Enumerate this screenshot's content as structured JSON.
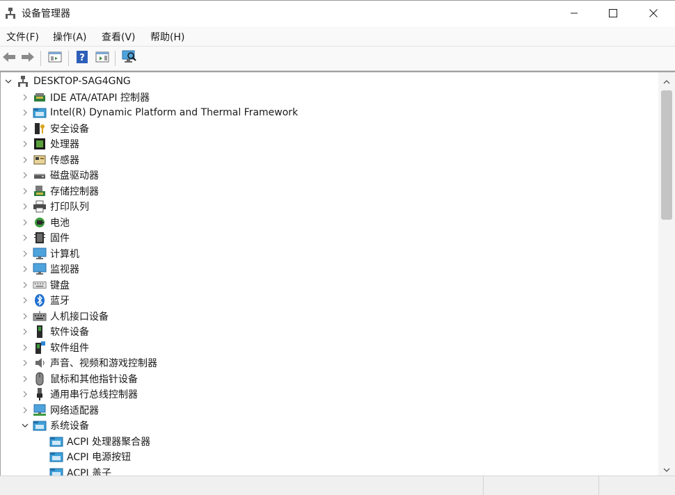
{
  "window": {
    "title": "设备管理器",
    "icon": "device-manager-icon",
    "controls": [
      "minimize-icon",
      "maximize-icon",
      "close-icon"
    ]
  },
  "menu": {
    "items": [
      {
        "label": "文件(F)"
      },
      {
        "label": "操作(A)"
      },
      {
        "label": "查看(V)"
      },
      {
        "label": "帮助(H)"
      }
    ]
  },
  "toolbar": {
    "buttons": [
      "back-arrow-icon",
      "forward-arrow-icon",
      "show-hide-console-tree-icon",
      "help-icon",
      "properties-pane-icon",
      "scan-hardware-icon"
    ]
  },
  "tree": {
    "root": {
      "label": "DESKTOP-SAG4GNG",
      "icon": "computer-network-icon",
      "expanded": true
    },
    "categories": [
      {
        "label": "IDE ATA/ATAPI 控制器",
        "icon": "ide-controller-icon",
        "expanded": false
      },
      {
        "label": "Intel(R) Dynamic Platform and Thermal Framework",
        "icon": "system-folder-icon",
        "expanded": false
      },
      {
        "label": "安全设备",
        "icon": "security-key-icon",
        "expanded": false
      },
      {
        "label": "处理器",
        "icon": "processor-chip-icon",
        "expanded": false
      },
      {
        "label": "传感器",
        "icon": "sensor-icon",
        "expanded": false
      },
      {
        "label": "磁盘驱动器",
        "icon": "disk-drive-icon",
        "expanded": false
      },
      {
        "label": "存储控制器",
        "icon": "storage-controller-icon",
        "expanded": false
      },
      {
        "label": "打印队列",
        "icon": "printer-icon",
        "expanded": false
      },
      {
        "label": "电池",
        "icon": "battery-icon",
        "expanded": false
      },
      {
        "label": "固件",
        "icon": "firmware-icon",
        "expanded": false
      },
      {
        "label": "计算机",
        "icon": "monitor-icon",
        "expanded": false
      },
      {
        "label": "监视器",
        "icon": "monitor-icon",
        "expanded": false
      },
      {
        "label": "键盘",
        "icon": "keyboard-icon",
        "expanded": false
      },
      {
        "label": "蓝牙",
        "icon": "bluetooth-icon",
        "expanded": false
      },
      {
        "label": "人机接口设备",
        "icon": "hid-icon",
        "expanded": false
      },
      {
        "label": "软件设备",
        "icon": "software-device-icon",
        "expanded": false
      },
      {
        "label": "软件组件",
        "icon": "software-component-icon",
        "expanded": false
      },
      {
        "label": "声音、视频和游戏控制器",
        "icon": "speaker-icon",
        "expanded": false
      },
      {
        "label": "鼠标和其他指针设备",
        "icon": "mouse-icon",
        "expanded": false
      },
      {
        "label": "通用串行总线控制器",
        "icon": "usb-icon",
        "expanded": false
      },
      {
        "label": "网络适配器",
        "icon": "network-adapter-icon",
        "expanded": false
      },
      {
        "label": "系统设备",
        "icon": "system-folder-icon",
        "expanded": true
      }
    ],
    "system_devices": [
      {
        "label": "ACPI 处理器聚合器",
        "icon": "system-folder-icon"
      },
      {
        "label": "ACPI 电源按钮",
        "icon": "system-folder-icon"
      },
      {
        "label": "ACPI 盖子",
        "icon": "system-folder-icon"
      }
    ]
  },
  "colors": {
    "accent_blue": "#2e86d6",
    "bluetooth_blue": "#1e6fd0",
    "folder_teal": "#3fa0d8"
  }
}
